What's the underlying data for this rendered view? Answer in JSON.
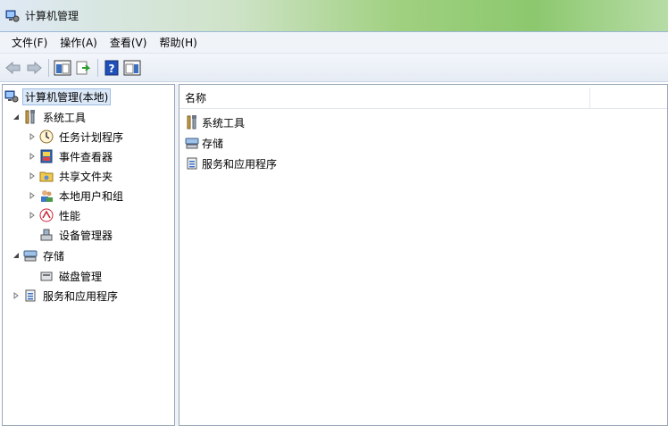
{
  "window": {
    "title": "计算机管理"
  },
  "menu": [
    "文件(F)",
    "操作(A)",
    "查看(V)",
    "帮助(H)"
  ],
  "tree": {
    "root": "计算机管理(本地)",
    "system_tools": "系统工具",
    "task_scheduler": "任务计划程序",
    "event_viewer": "事件查看器",
    "shared_folders": "共享文件夹",
    "local_users": "本地用户和组",
    "performance": "性能",
    "device_manager": "设备管理器",
    "storage": "存储",
    "disk_management": "磁盘管理",
    "services_apps": "服务和应用程序"
  },
  "list": {
    "header_name": "名称",
    "items": [
      "系统工具",
      "存储",
      "服务和应用程序"
    ]
  }
}
